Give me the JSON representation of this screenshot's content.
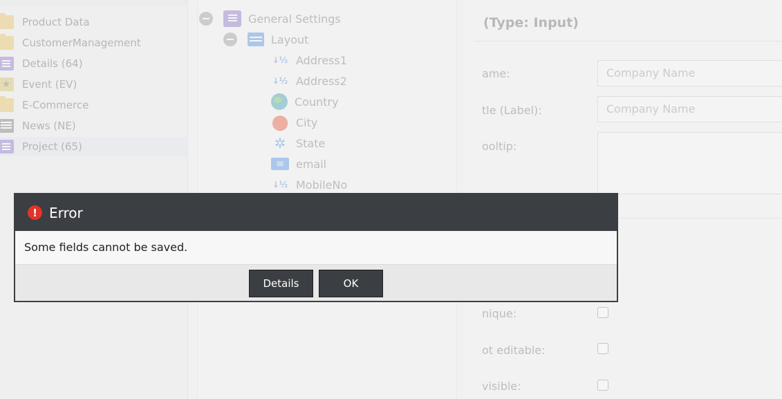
{
  "classes": [
    {
      "label": "Product Data",
      "icon": "folder-icon"
    },
    {
      "label": "CustomerManagement",
      "icon": "folder-icon"
    },
    {
      "label": "Details (64)",
      "icon": "class-icon"
    },
    {
      "label": "Event (EV)",
      "icon": "star-icon"
    },
    {
      "label": "E-Commerce",
      "icon": "folder-icon"
    },
    {
      "label": "News (NE)",
      "icon": "news-icon"
    },
    {
      "label": "Project (65)",
      "icon": "class-icon"
    }
  ],
  "tree": {
    "root": "General Settings",
    "layout": "Layout",
    "fields": [
      {
        "label": "Address1",
        "icon": "number-icon"
      },
      {
        "label": "Address2",
        "icon": "number-icon"
      },
      {
        "label": "Country",
        "icon": "country-icon"
      },
      {
        "label": "City",
        "icon": "location-pin-icon"
      },
      {
        "label": "State",
        "icon": "state-icon"
      },
      {
        "label": "email",
        "icon": "email-icon"
      },
      {
        "label": "MobileNo",
        "icon": "number-icon"
      }
    ]
  },
  "editor": {
    "heading": "(Type: Input)",
    "name_label": "ame:",
    "name_value": "Company Name",
    "title_label": "tle (Label):",
    "title_value": "Company Name",
    "tooltip_label": "ooltip:",
    "unique_label": "nique:",
    "not_editable_label": "ot editable:",
    "invisible_label": "visible:"
  },
  "modal": {
    "title": "Error",
    "message": "Some fields cannot be saved.",
    "details_button": "Details",
    "ok_button": "OK",
    "icon": "error-icon"
  }
}
